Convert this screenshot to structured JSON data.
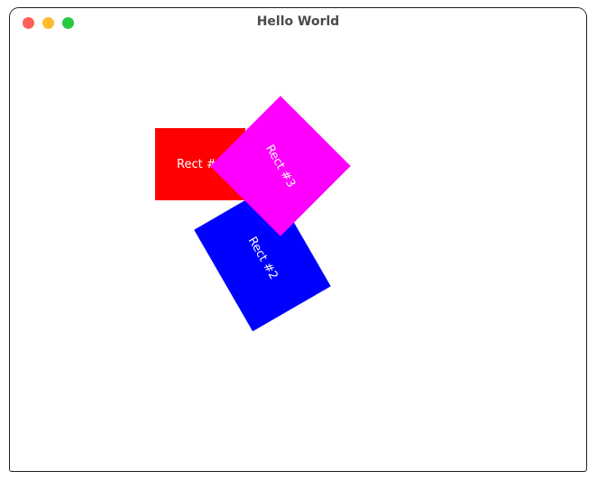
{
  "window": {
    "title": "Hello World"
  },
  "colors": {
    "close": "#ff5f57",
    "minimize": "#febc2e",
    "maximize": "#28c840"
  },
  "rects": [
    {
      "label": "Rect #1",
      "color": "#ff0000",
      "rotation_deg": 0
    },
    {
      "label": "Rect #2",
      "color": "#0000ff",
      "rotation_deg": -30
    },
    {
      "label": "Rect #3",
      "color": "#ff00ff",
      "rotation_deg": 45
    }
  ]
}
